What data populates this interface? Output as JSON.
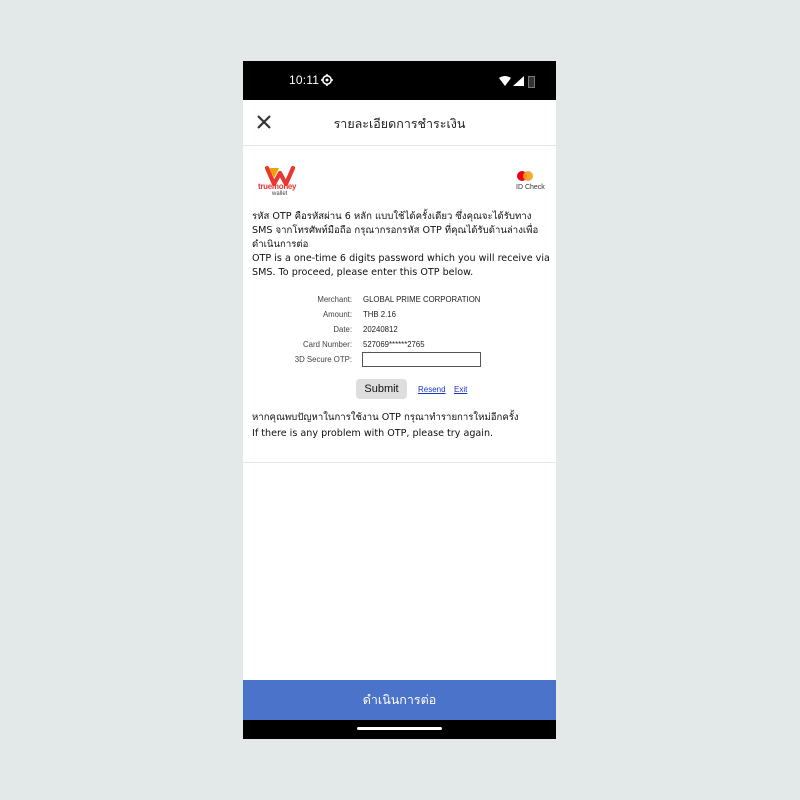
{
  "status_bar": {
    "time": "10:11"
  },
  "header": {
    "title": "รายละเอียดการชำระเงิน"
  },
  "brand": {
    "wallet_name_line1": "truemoney",
    "wallet_name_line2": "wallet",
    "card_scheme_text": "ID Check"
  },
  "message": {
    "thai": "รหัส OTP คือรหัสผ่าน 6 หลัก แบบใช้ได้ครั้งเดียว ซึ่งคุณจะได้รับทาง SMS จากโทรศัพท์มือถือ กรุณากรอกรหัส OTP ที่คุณได้รับด้านล่างเพื่อดำเนินการต่อ",
    "english": "OTP is a one-time 6 digits password which you will receive via SMS. To proceed, please enter this OTP below."
  },
  "details": {
    "merchant_label": "Merchant:",
    "merchant_value": "GLOBAL PRIME CORPORATION",
    "amount_label": "Amount:",
    "amount_value": "THB 2.16",
    "date_label": "Date:",
    "date_value": "20240812",
    "card_label": "Card Number:",
    "card_value": "527069******2765",
    "otp_label": "3D Secure OTP:",
    "otp_value": ""
  },
  "actions": {
    "submit": "Submit",
    "resend": "Resend",
    "exit": "Exit"
  },
  "help": {
    "thai": "หากคุณพบปัญหาในการใช้งาน OTP กรุณาทำรายการใหม่อีกครั้ง",
    "english": "If there is any problem with OTP, please try again."
  },
  "footer": {
    "continue_label": "ดำเนินการต่อ"
  },
  "colors": {
    "continue_button": "#4b73c9",
    "truemoney_red": "#e8372f",
    "truemoney_orange": "#f5a000",
    "link": "#1a33cc"
  }
}
